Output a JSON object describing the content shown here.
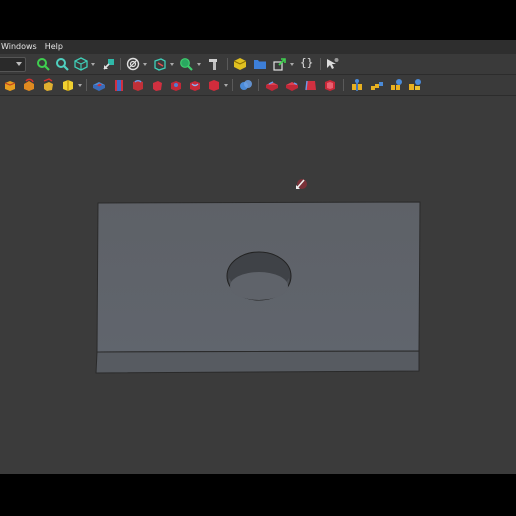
{
  "menu": {
    "windows": "Windows",
    "help": "Help"
  },
  "toolbar1": {
    "icons": [
      "zoom-fit-all-icon",
      "zoom-fit-selection-icon",
      "view-isometric-icon",
      "select-cursor-icon",
      "draw-style-icon",
      "bounding-box-icon",
      "zoom-in-icon",
      "measure-icon",
      "part-icon",
      "group-icon",
      "link-icon",
      "macro-braces-icon",
      "whats-this-icon"
    ],
    "braces_label": "{}"
  },
  "toolbar2": {
    "icons": [
      "pad-icon",
      "revolve-icon",
      "loft-icon",
      "additive-primitive-icon",
      "pocket-icon",
      "hole-icon",
      "groove-icon",
      "subtractive-loft-icon",
      "subtractive-pipe-icon",
      "subtractive-helix-icon",
      "subtractive-primitive-icon",
      "boolean-icon",
      "fillet-icon",
      "chamfer-icon",
      "draft-icon",
      "thickness-icon",
      "mirrored-icon",
      "linear-pattern-icon",
      "polar-pattern-icon",
      "multi-transform-icon"
    ]
  },
  "viewport": {
    "model": "plate-with-hole",
    "colors": {
      "background": "#3b3b3b",
      "top_face": "#5f636a",
      "front_face": "#575b61",
      "edge": "#2a2a2a"
    }
  }
}
